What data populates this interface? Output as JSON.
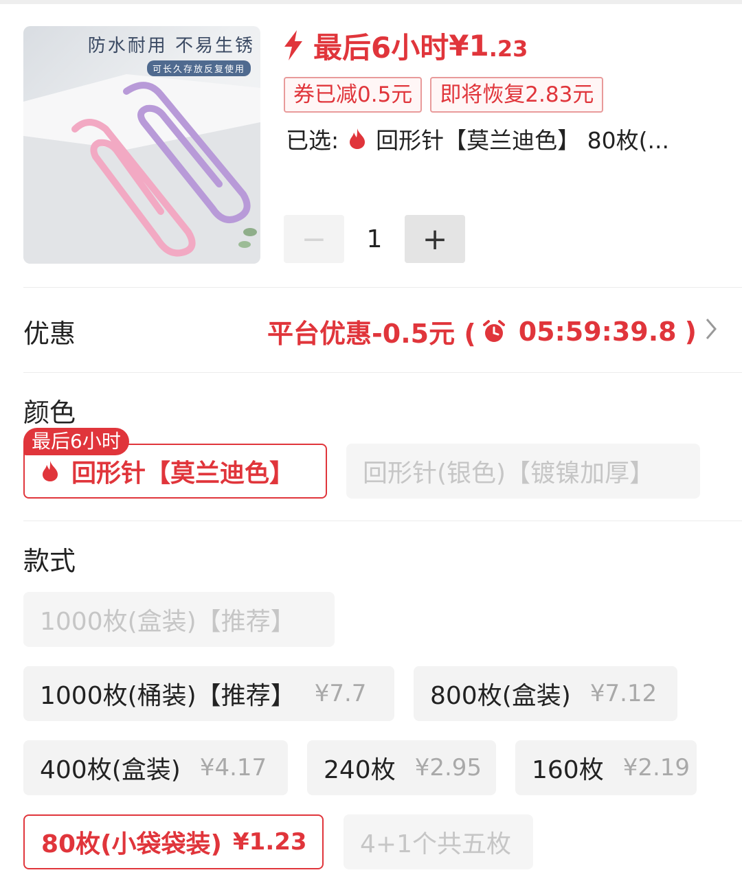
{
  "product": {
    "image_headline": "防水耐用 不易生锈",
    "image_subline": "可长久存放反复使用"
  },
  "price_header": {
    "label": "最后6小时",
    "price_integer": "¥1",
    "price_decimal": ".23",
    "coupon_tag": "券已减0.5元",
    "restore_tag": "即将恢复2.83元"
  },
  "selection": {
    "prefix": "已选:",
    "text": "回形针【莫兰迪色】 80枚(..."
  },
  "quantity": {
    "minus_label": "−",
    "value": "1",
    "plus_label": "+"
  },
  "promo": {
    "label": "优惠",
    "value": "平台优惠-0.5元 (",
    "countdown": "05:59:39.8",
    "close": ")"
  },
  "color_section": {
    "label": "颜色",
    "badge": "最后6小时",
    "options": [
      {
        "label": "回形针【莫兰迪色】",
        "state": "selected"
      },
      {
        "label": "回形针(银色)【镀镍加厚】",
        "state": "disabled"
      }
    ]
  },
  "style_section": {
    "label": "款式",
    "options": [
      {
        "label": "1000枚(盒装)【推荐】",
        "price": "",
        "state": "disabled"
      },
      {
        "label": "1000枚(桶装)【推荐】",
        "price": "¥7.7",
        "state": "available"
      },
      {
        "label": "800枚(盒装)",
        "price": "¥7.12",
        "state": "available"
      },
      {
        "label": "400枚(盒装)",
        "price": "¥4.17",
        "state": "available"
      },
      {
        "label": "240枚",
        "price": "¥2.95",
        "state": "available"
      },
      {
        "label": "160枚",
        "price": "¥2.19",
        "state": "available"
      },
      {
        "label": "80枚(小袋袋装)",
        "price": "¥1.23",
        "state": "selected"
      },
      {
        "label": "4+1个共五枚",
        "price": "",
        "state": "disabled"
      }
    ]
  },
  "colors": {
    "accent": "#e0353b",
    "disabled_text": "#c6c6c6",
    "option_bg": "#f3f3f3"
  }
}
